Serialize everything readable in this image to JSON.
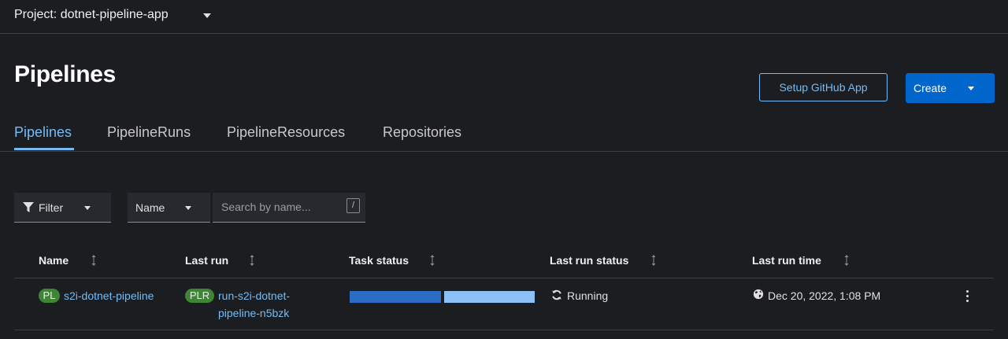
{
  "project": {
    "label": "Project: dotnet-pipeline-app"
  },
  "page": {
    "title": "Pipelines"
  },
  "actions": {
    "setup_github": "Setup GitHub App",
    "create": "Create"
  },
  "tabs": [
    {
      "label": "Pipelines",
      "active": true
    },
    {
      "label": "PipelineRuns",
      "active": false
    },
    {
      "label": "PipelineResources",
      "active": false
    },
    {
      "label": "Repositories",
      "active": false
    }
  ],
  "toolbar": {
    "filter_label": "Filter",
    "name_select": "Name",
    "search_placeholder": "Search by name...",
    "shortcut_key": "/"
  },
  "table": {
    "columns": [
      "Name",
      "Last run",
      "Task status",
      "Last run status",
      "Last run time"
    ],
    "rows": [
      {
        "name_badge": "PL",
        "name": "s2i-dotnet-pipeline",
        "last_run_badge": "PLR",
        "last_run_line1": "run-s2i-dotnet-",
        "last_run_line2": "pipeline-n5bzk",
        "task_status": {
          "done_fraction": 0.5,
          "running_fraction": 0.5
        },
        "last_run_status": "Running",
        "last_run_time": "Dec 20, 2022, 1:08 PM"
      }
    ]
  },
  "colors": {
    "accent": "#73bcf7",
    "primary": "#0066cc",
    "badge_green": "#3e8635",
    "task_done": "#2b6cc4",
    "task_running": "#8bc1f7"
  }
}
